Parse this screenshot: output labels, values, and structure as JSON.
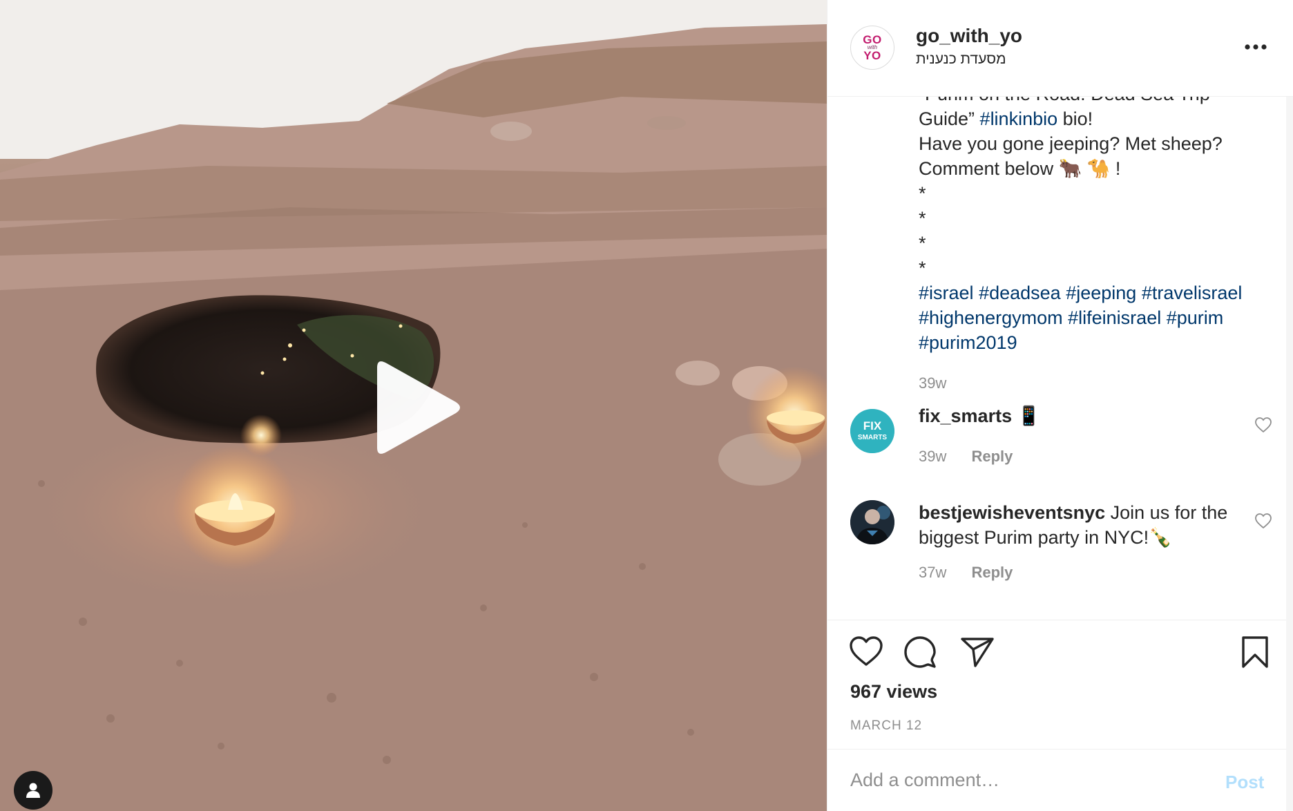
{
  "post": {
    "username": "go_with_yo",
    "location": "מסעדת כנענית",
    "avatar_logo": {
      "top": "GO",
      "middle": "with",
      "bottom": "YO"
    },
    "more_icon": "more-horizontal-icon"
  },
  "caption": {
    "lines": [
      [
        {
          "text": "“Purim on the Road: Dead Sea Trip",
          "tag": false
        }
      ],
      [
        {
          "text": "Guide” ",
          "tag": false
        },
        {
          "text": "#linkinbio",
          "tag": true
        },
        {
          "text": " bio!",
          "tag": false
        }
      ],
      [
        {
          "text": "Have you gone jeeping? Met sheep?",
          "tag": false
        }
      ],
      [
        {
          "text": "Comment below 🐂 🐪 !",
          "tag": false
        }
      ],
      [
        {
          "text": "*",
          "tag": false
        }
      ],
      [
        {
          "text": "*",
          "tag": false
        }
      ],
      [
        {
          "text": "*",
          "tag": false
        }
      ],
      [
        {
          "text": "*",
          "tag": false
        }
      ],
      [
        {
          "text": "#israel",
          "tag": true
        },
        {
          "text": " ",
          "tag": false
        },
        {
          "text": "#deadsea",
          "tag": true
        },
        {
          "text": " ",
          "tag": false
        },
        {
          "text": "#jeeping",
          "tag": true
        },
        {
          "text": " ",
          "tag": false
        },
        {
          "text": "#travelisrael",
          "tag": true
        }
      ],
      [
        {
          "text": "#highenergymom",
          "tag": true
        },
        {
          "text": " ",
          "tag": false
        },
        {
          "text": "#lifeinisrael",
          "tag": true
        },
        {
          "text": " ",
          "tag": false
        },
        {
          "text": "#purim",
          "tag": true
        }
      ],
      [
        {
          "text": "#purim2019",
          "tag": true
        }
      ]
    ],
    "time": "39w"
  },
  "comments": [
    {
      "user": "fix_smarts",
      "text": "📱",
      "time": "39w",
      "reply_label": "Reply",
      "avatar_label": "FIX SMARTS"
    },
    {
      "user": "bestjewisheventsnyc",
      "text": "Join us for the biggest Purim party in NYC!🍾",
      "time": "37w",
      "reply_label": "Reply"
    }
  ],
  "actions": {
    "like_icon": "heart-icon",
    "comment_icon": "comment-bubble-icon",
    "share_icon": "paper-plane-icon",
    "save_icon": "bookmark-icon"
  },
  "stats": {
    "views": "967 views",
    "date": "MARCH 12"
  },
  "add_comment": {
    "placeholder": "Add a comment…",
    "post_label": "Post"
  },
  "colors": {
    "hashtag": "#00376b",
    "muted": "#8e8e8e",
    "post_disabled": "#b2dffc",
    "text": "#262626"
  }
}
